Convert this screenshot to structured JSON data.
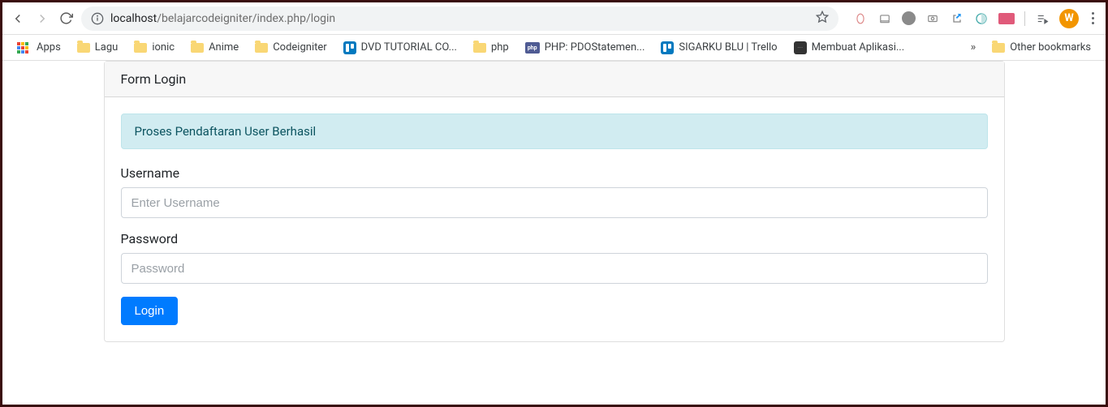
{
  "browser": {
    "url_host": "localhost",
    "url_path": "/belajarcodeigniter/index.php/login",
    "profile_letter": "W"
  },
  "bookmarks": {
    "apps": "Apps",
    "items": [
      {
        "label": "Lagu",
        "icon": "folder"
      },
      {
        "label": "ionic",
        "icon": "folder"
      },
      {
        "label": "Anime",
        "icon": "folder"
      },
      {
        "label": "Codeigniter",
        "icon": "folder"
      },
      {
        "label": "DVD TUTORIAL CO...",
        "icon": "trello"
      },
      {
        "label": "php",
        "icon": "folder"
      },
      {
        "label": "PHP: PDOStatemen...",
        "icon": "php"
      },
      {
        "label": "SIGARKU BLU | Trello",
        "icon": "trello"
      },
      {
        "label": "Membuat Aplikasi...",
        "icon": "dark"
      }
    ],
    "other": "Other bookmarks"
  },
  "page": {
    "card_title": "Form Login",
    "alert": "Proses Pendaftaran User Berhasil",
    "username_label": "Username",
    "username_placeholder": "Enter Username",
    "password_label": "Password",
    "password_placeholder": "Password",
    "submit_label": "Login"
  }
}
